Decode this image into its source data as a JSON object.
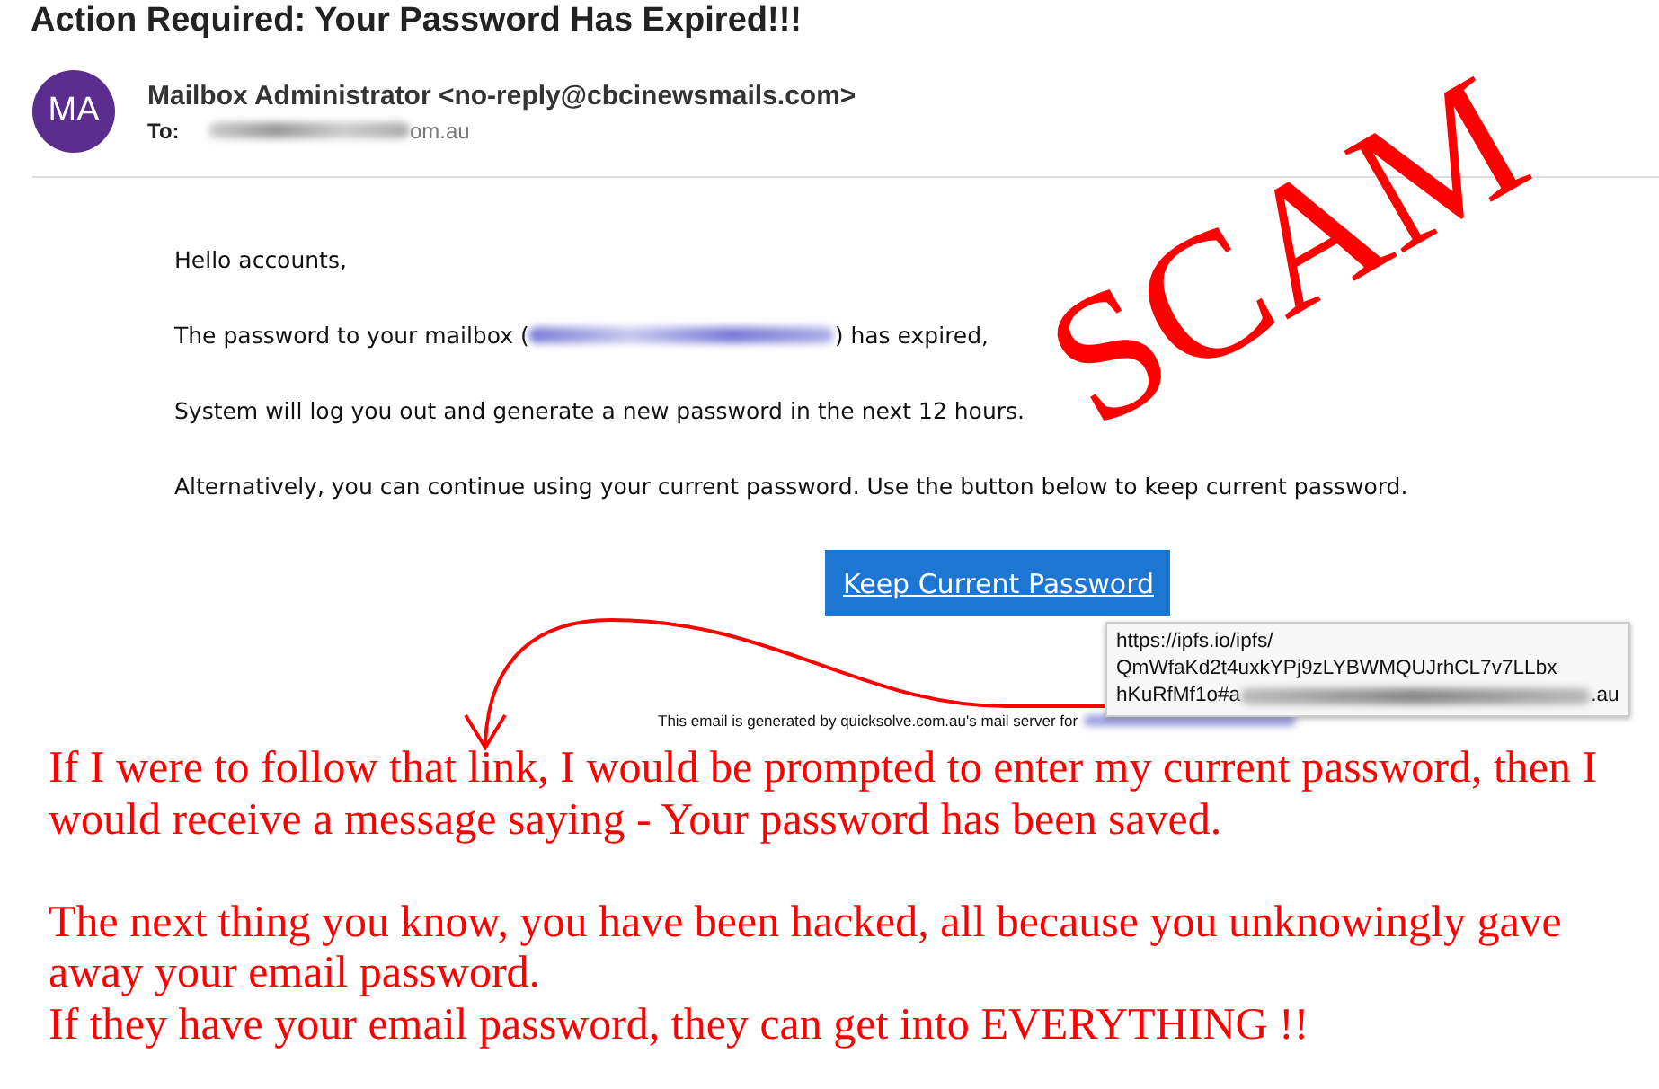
{
  "email": {
    "subject": "Action Required: Your Password Has Expired!!!",
    "sender": {
      "initials": "MA",
      "from": "Mailbox Administrator <no-reply@cbcinewsmails.com>",
      "to_label": "To:",
      "to_tail": "om.au"
    },
    "body": {
      "greeting": "Hello accounts,",
      "mailbox_line": {
        "before": "The password to your mailbox (",
        "after": ") has expired,"
      },
      "paragraphs": [
        "System will log you out and generate a new password in the next 12 hours.",
        "Alternatively, you can continue using your current password. Use the button below to keep current password."
      ],
      "button": "Keep Current Password",
      "link_tooltip": {
        "lines": [
          "https://ipfs.io/ipfs/",
          "QmWfaKd2t4uxkYPj9zLYBWMQUJrhCL7v7LLbx"
        ],
        "last_before": "hKuRfMf1o#a",
        "last_after": ".au"
      },
      "footer": "This email is generated by quicksolve.com.au's mail server for"
    }
  },
  "annotations": {
    "stamp": "SCAM",
    "notes": [
      "If I were to follow that link, I would be prompted to enter my current password, then I would receive a message saying - Your password has been saved.",
      "The next thing you know, you have been hacked, all because you unknowingly gave away your email password.",
      "If they have your email password, they can get into EVERYTHING !!"
    ]
  }
}
